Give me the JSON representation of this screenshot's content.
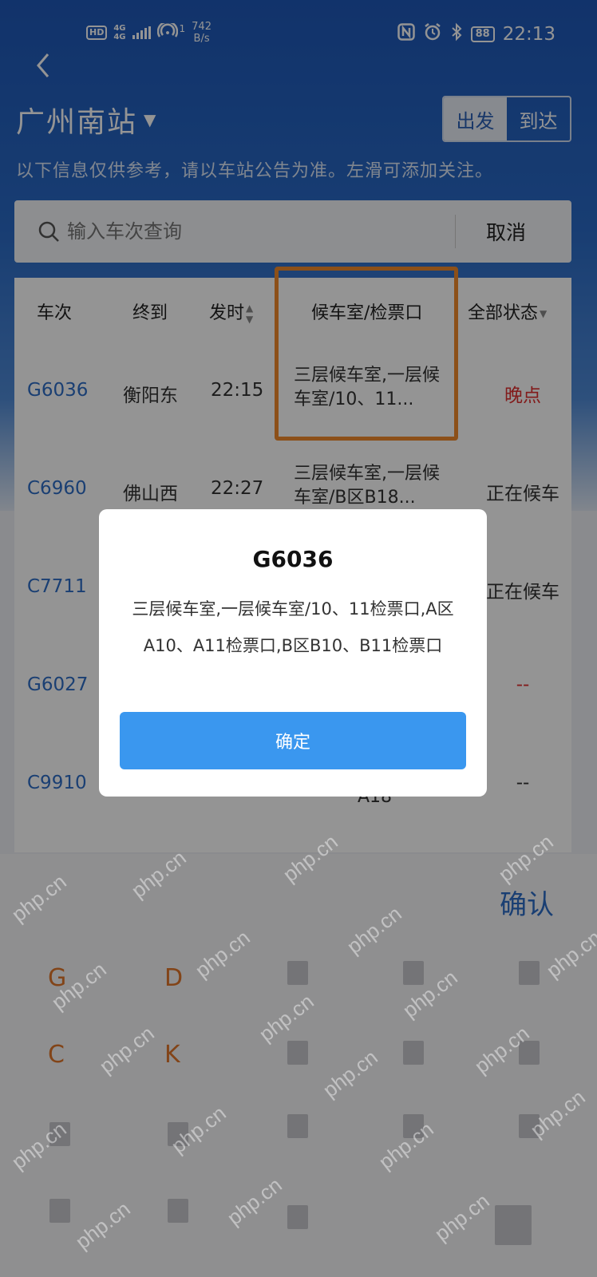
{
  "status_bar": {
    "hd": "HD",
    "network_top": "4G",
    "network_bottom": "4G",
    "hotspot_count": "1",
    "speed_value": "742",
    "speed_unit": "B/s",
    "battery": "88",
    "time": "22:13"
  },
  "header": {
    "station": "广州南站",
    "tabs": [
      "出发",
      "到达"
    ],
    "notice": "以下信息仅供参考，请以车站公告为准。左滑可添加关注。"
  },
  "search": {
    "placeholder": "输入车次查询",
    "cancel": "取消"
  },
  "table": {
    "headers": [
      "车次",
      "终到",
      "发时",
      "候车室/检票口",
      "全部状态"
    ],
    "rows": [
      {
        "code": "G6036",
        "dest": "衡阳东",
        "time": "22:15",
        "room": "三层候车室,一层候车室/10、11...",
        "status": "晚点"
      },
      {
        "code": "C6960",
        "dest": "佛山西",
        "time": "22:27",
        "room": "三层候车室,一层候车室/B区B18...",
        "status": "正在候车"
      },
      {
        "code": "C7711",
        "dest": "",
        "time": "",
        "room": "",
        "status": "正在候车"
      },
      {
        "code": "G6027",
        "dest": "",
        "time": "",
        "room": "",
        "status": "--"
      },
      {
        "code": "C9910",
        "dest": "",
        "time": "",
        "room": "A18",
        "status": "--"
      }
    ]
  },
  "keyboard": {
    "confirm": "确认",
    "keys": [
      "G",
      "D",
      "C",
      "K"
    ]
  },
  "watermark": "php.cn",
  "modal": {
    "title": "G6036",
    "body": "三层候车室,一层候车室/10、11检票口,A区A10、A11检票口,B区B10、B11检票口",
    "button": "确定"
  },
  "colors": {
    "brand_blue": "#2e6dc6",
    "late_red": "#e03030",
    "highlight_orange": "#f28a2c",
    "button_blue": "#3a97ef"
  }
}
